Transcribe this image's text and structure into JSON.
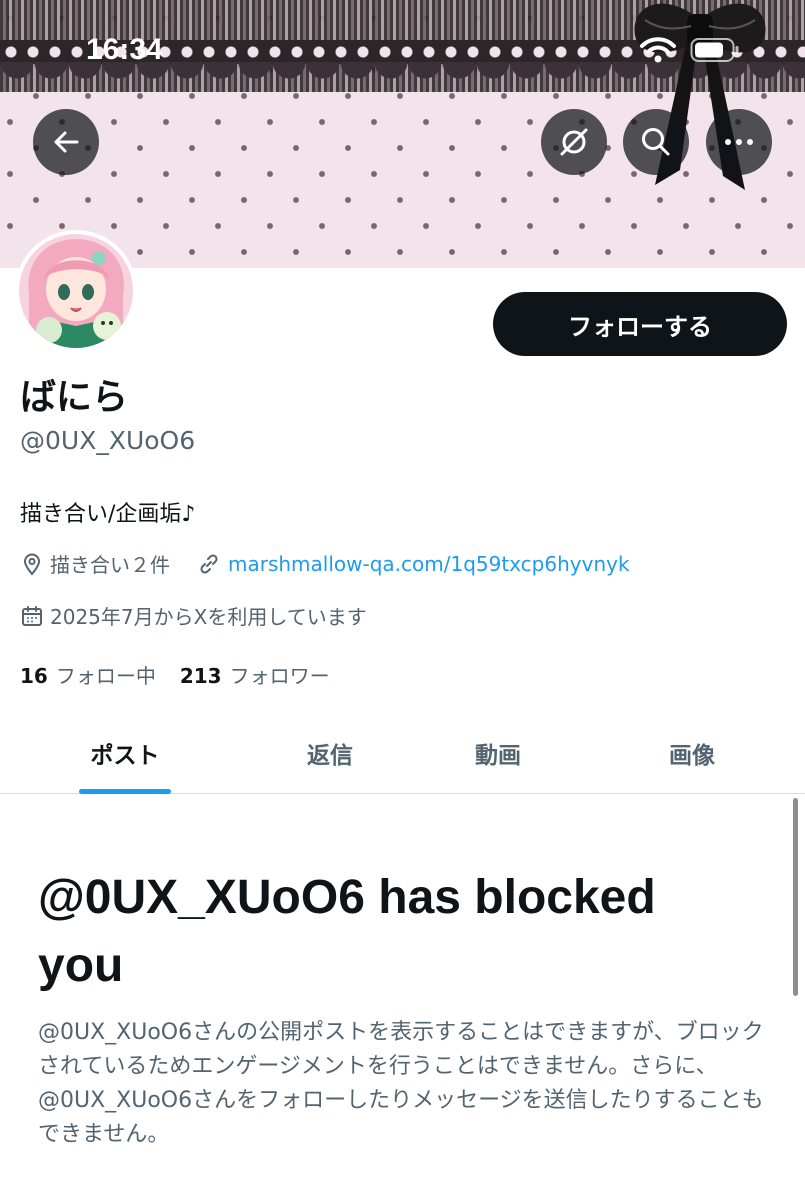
{
  "status_bar": {
    "time": "16:34"
  },
  "header": {
    "back_icon": "arrow-left-icon",
    "grok_icon": "slash-circle-icon",
    "search_icon": "search-icon",
    "more_icon": "more-icon"
  },
  "profile": {
    "follow_button_label": "フォローする",
    "display_name": "ばにら",
    "handle": "@0UX_XUoO6",
    "bio": "描き合い/企画垢♪",
    "location": "描き合い２件",
    "website": "marshmallow-qa.com/1q59txcp6hyvnyk",
    "joined": "2025年7月からXを利用しています",
    "following_count": "16",
    "following_label": "フォロー中",
    "followers_count": "213",
    "followers_label": "フォロワー"
  },
  "tabs": [
    {
      "label": "ポスト",
      "active": true
    },
    {
      "label": "返信",
      "active": false
    },
    {
      "label": "動画",
      "active": false
    },
    {
      "label": "画像",
      "active": false
    }
  ],
  "blocked": {
    "title": "@0UX_XUoO6 has blocked you",
    "description": "@0UX_XUoO6さんの公開ポストを表示することはできますが、ブロックされているためエンゲージメントを行うことはできません。さらに、@0UX_XUoO6さんをフォローしたりメッセージを送信したりすることもできません。"
  },
  "colors": {
    "accent": "#1d9bf0",
    "text_primary": "#0f1419",
    "text_secondary": "#536471",
    "banner": "#f2e4ea"
  }
}
